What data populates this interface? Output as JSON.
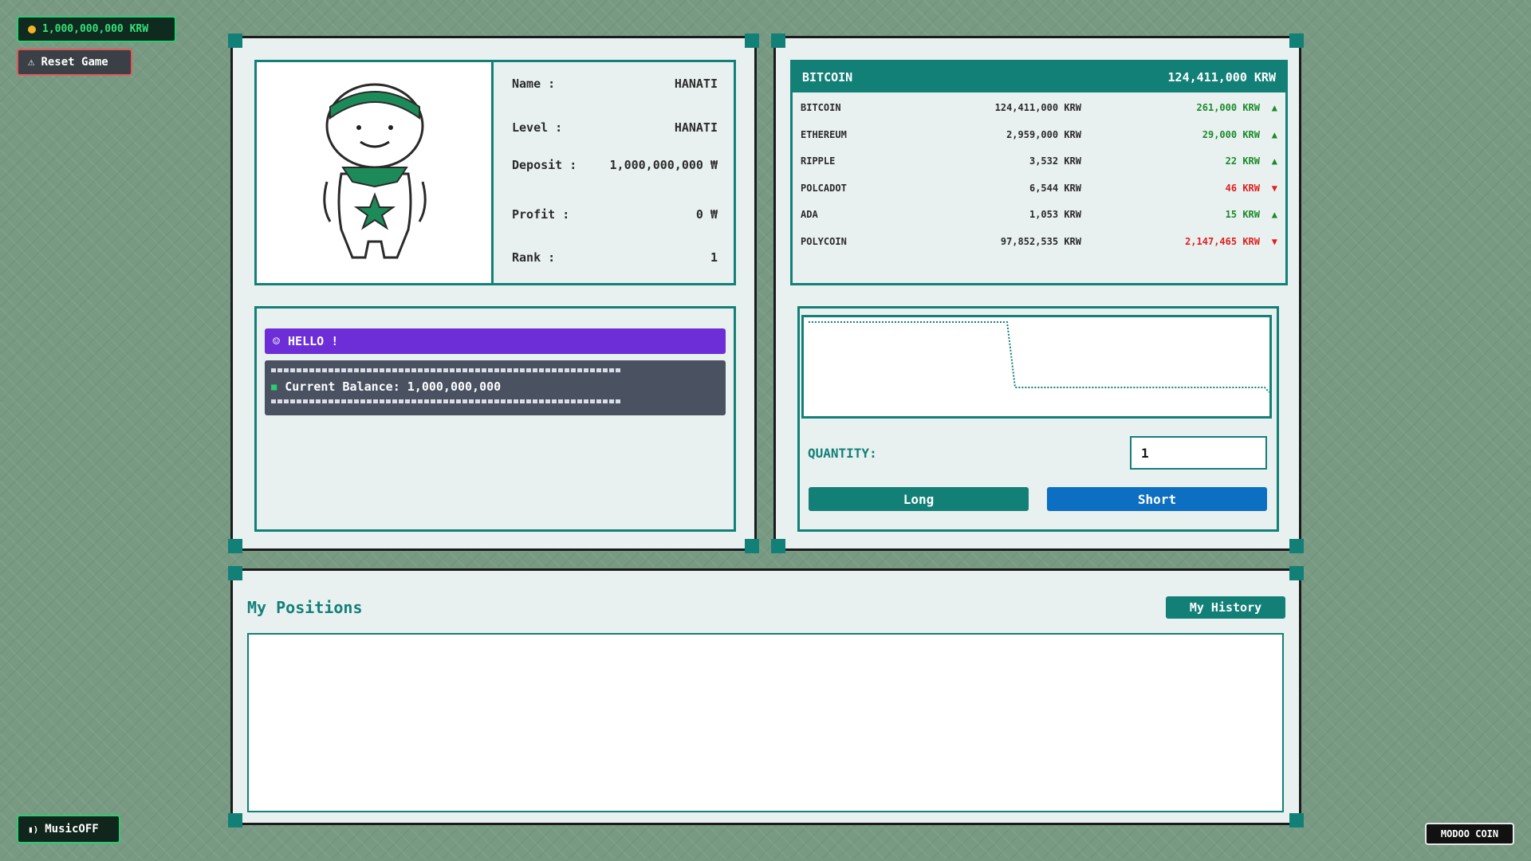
{
  "header": {
    "balance": "1,000,000,000 KRW",
    "reset_label": "Reset Game"
  },
  "profile": {
    "fields": [
      {
        "label": "Name :",
        "value": "HANATI"
      },
      {
        "label": "Level :",
        "value": "HANATI"
      },
      {
        "label": "Deposit :",
        "value": "1,000,000,000 ₩"
      },
      {
        "label": "Profit :",
        "value": "0 ₩"
      },
      {
        "label": "Rank :",
        "value": "1"
      }
    ]
  },
  "messages": {
    "hello": "HELLO !",
    "balance_line": "Current Balance: 1,000,000,000"
  },
  "market": {
    "selected_name": "BITCOIN",
    "selected_price": "124,411,000 KRW",
    "coins": [
      {
        "name": "BITCOIN",
        "price": "124,411,000 KRW",
        "change": "261,000 KRW",
        "direction": "up"
      },
      {
        "name": "ETHEREUM",
        "price": "2,959,000 KRW",
        "change": "29,000 KRW",
        "direction": "up"
      },
      {
        "name": "RIPPLE",
        "price": "3,532 KRW",
        "change": "22 KRW",
        "direction": "up"
      },
      {
        "name": "POLCADOT",
        "price": "6,544 KRW",
        "change": "46 KRW",
        "direction": "down"
      },
      {
        "name": "ADA",
        "price": "1,053 KRW",
        "change": "15 KRW",
        "direction": "up"
      },
      {
        "name": "POLYCOIN",
        "price": "97,852,535 KRW",
        "change": "2,147,465 KRW",
        "direction": "down"
      }
    ]
  },
  "trade": {
    "quantity_label": "QUANTITY:",
    "quantity_value": "1",
    "long_label": "Long",
    "short_label": "Short"
  },
  "positions": {
    "title": "My Positions",
    "history_label": "My History"
  },
  "footer": {
    "music_label": "MusicOFF",
    "brand": "MODOO COIN"
  },
  "colors": {
    "teal": "#138078",
    "purple": "#6d2ed8",
    "up": "#1a8a2a",
    "down": "#e01f1f",
    "short_blue": "#0d6fc2"
  }
}
